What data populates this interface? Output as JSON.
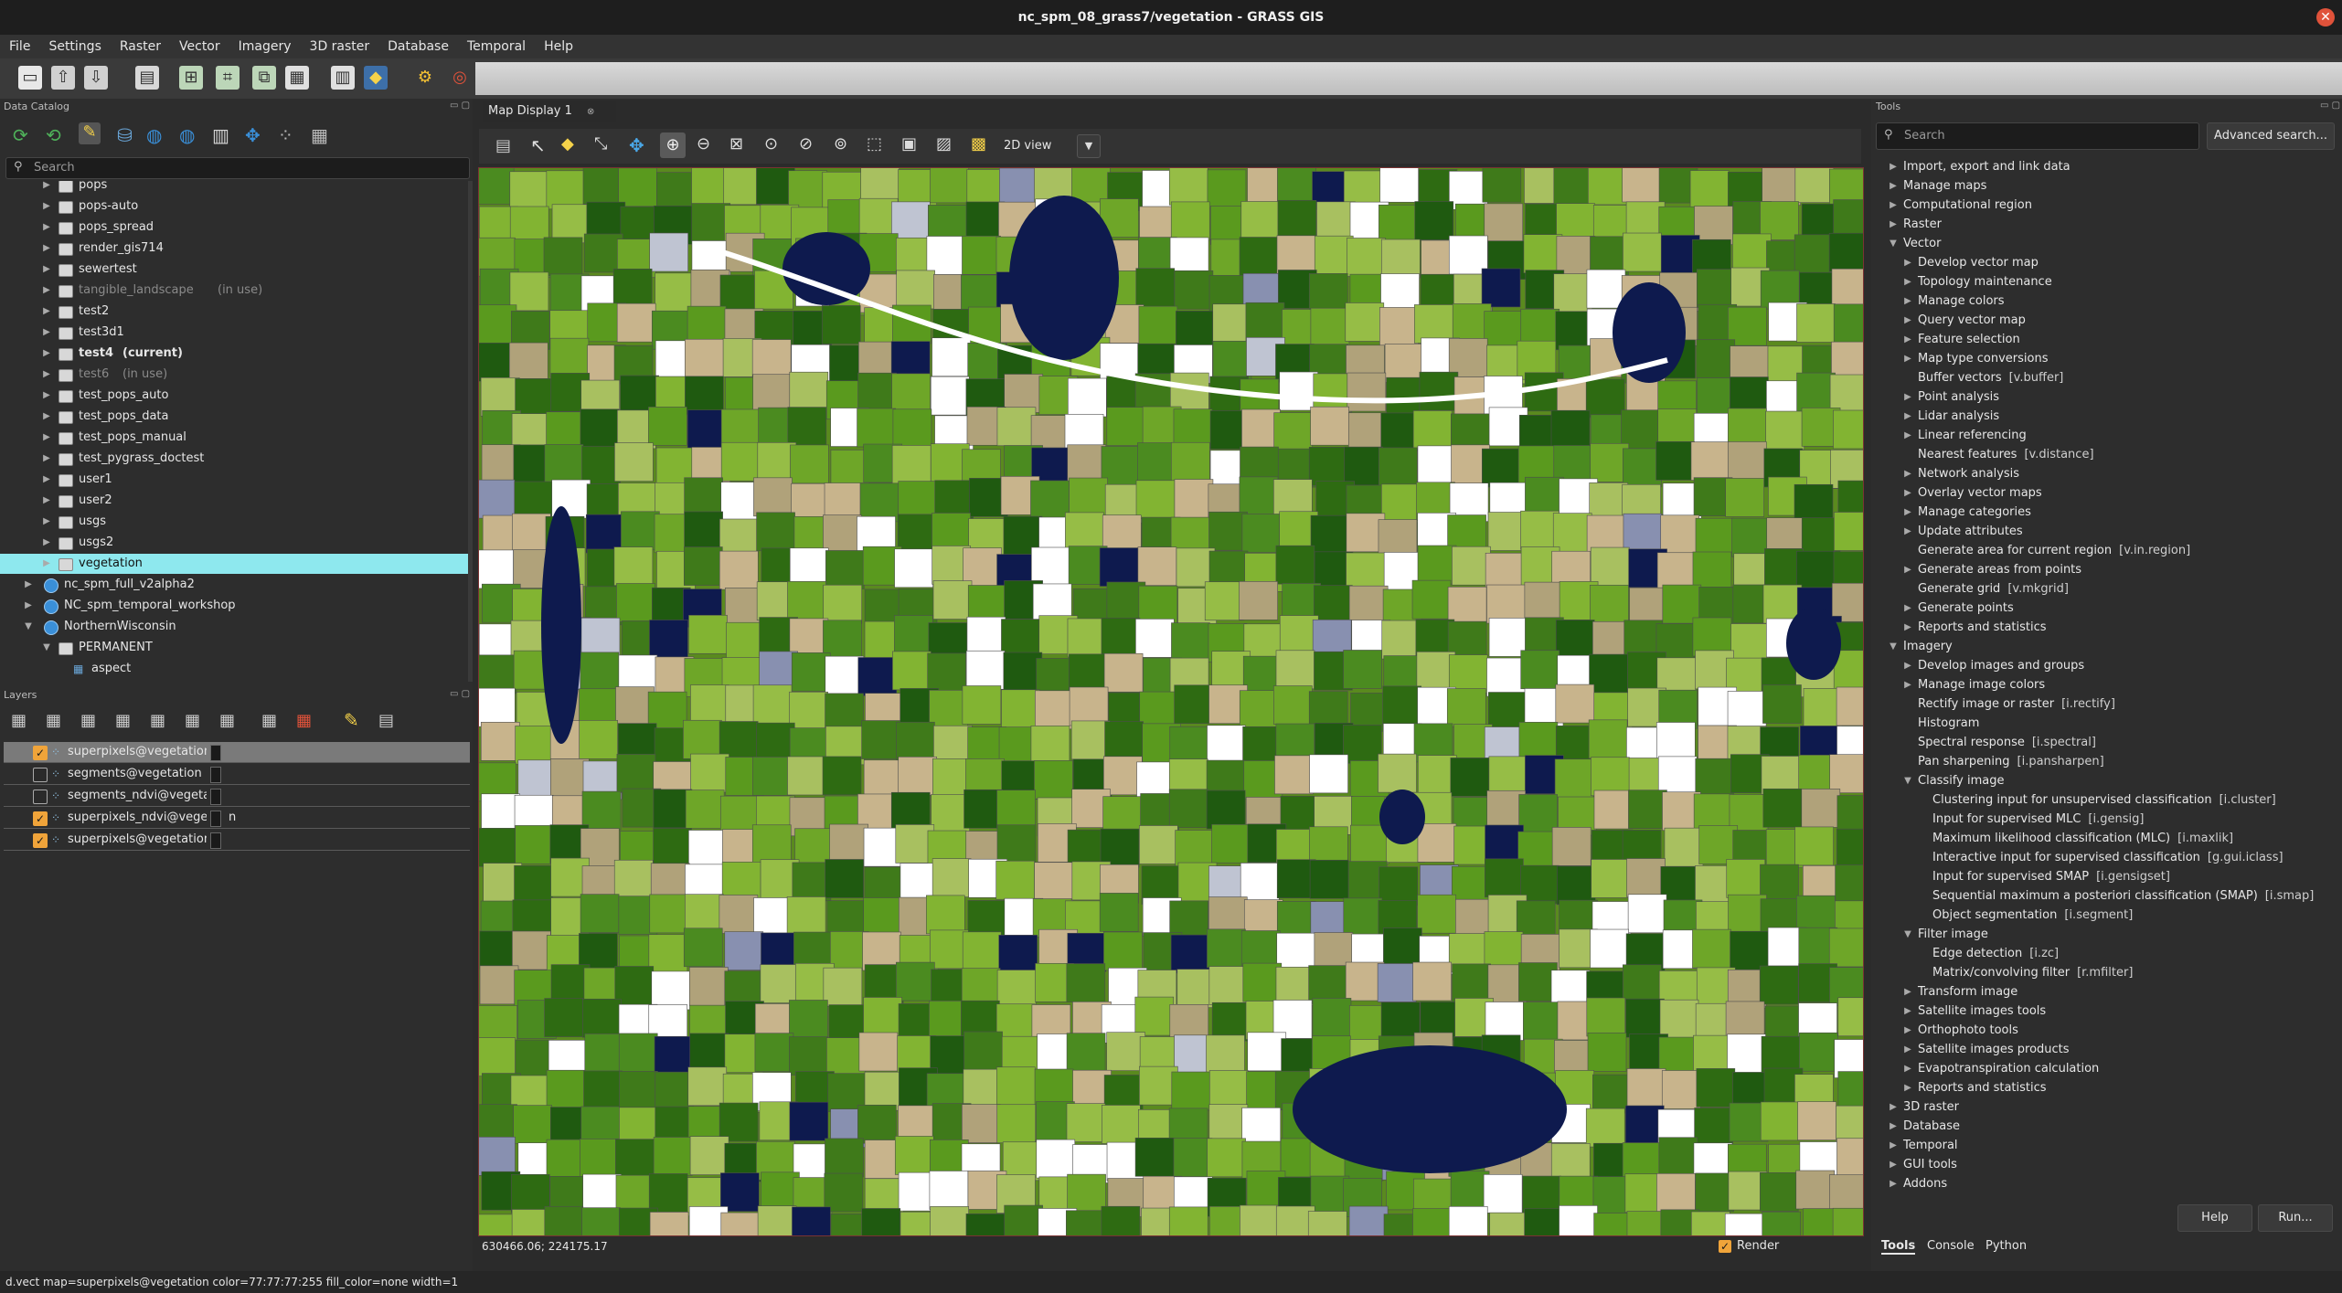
{
  "window": {
    "title": "nc_spm_08_grass7/vegetation - GRASS GIS"
  },
  "menubar": [
    "File",
    "Settings",
    "Raster",
    "Vector",
    "Imagery",
    "3D raster",
    "Database",
    "Temporal",
    "Help"
  ],
  "data_catalog": {
    "header": "Data Catalog",
    "search_placeholder": "Search",
    "items": [
      {
        "label": "pops",
        "suffix": "",
        "style": "normal"
      },
      {
        "label": "pops-auto",
        "suffix": "",
        "style": "normal"
      },
      {
        "label": "pops_spread",
        "suffix": "",
        "style": "normal"
      },
      {
        "label": "render_gis714",
        "suffix": "",
        "style": "normal"
      },
      {
        "label": "sewertest",
        "suffix": "",
        "style": "normal"
      },
      {
        "label": "tangible_landscape",
        "suffix": "(in use)",
        "style": "grey"
      },
      {
        "label": "test2",
        "suffix": "",
        "style": "normal"
      },
      {
        "label": "test3d1",
        "suffix": "",
        "style": "normal"
      },
      {
        "label": "test4",
        "suffix": "(current)",
        "style": "bold"
      },
      {
        "label": "test6",
        "suffix": "(in use)",
        "style": "grey"
      },
      {
        "label": "test_pops_auto",
        "suffix": "",
        "style": "normal"
      },
      {
        "label": "test_pops_data",
        "suffix": "",
        "style": "normal"
      },
      {
        "label": "test_pops_manual",
        "suffix": "",
        "style": "normal"
      },
      {
        "label": "test_pygrass_doctest",
        "suffix": "",
        "style": "normal"
      },
      {
        "label": "user1",
        "suffix": "",
        "style": "normal"
      },
      {
        "label": "user2",
        "suffix": "",
        "style": "normal"
      },
      {
        "label": "usgs",
        "suffix": "",
        "style": "normal"
      },
      {
        "label": "usgs2",
        "suffix": "",
        "style": "normal"
      },
      {
        "label": "vegetation",
        "suffix": "",
        "style": "selected"
      }
    ],
    "locations": [
      {
        "label": "nc_spm_full_v2alpha2"
      },
      {
        "label": "NC_spm_temporal_workshop"
      },
      {
        "label": "NorthernWisconsin"
      }
    ],
    "permanent": "PERMANENT",
    "aspect": "aspect"
  },
  "layers": {
    "header": "Layers",
    "items": [
      {
        "name": "superpixels@vegetation",
        "checked": true,
        "selected": true
      },
      {
        "name": "segments@vegetation",
        "checked": false,
        "selected": false
      },
      {
        "name": "segments_ndvi@vegetat",
        "checked": false,
        "selected": false
      },
      {
        "name": "superpixels_ndvi@veget",
        "checked": true,
        "selected": false,
        "trail": "n"
      },
      {
        "name": "superpixels@vegetation",
        "checked": true,
        "selected": false
      }
    ]
  },
  "map_display": {
    "tab_label": "Map Display 1",
    "view_mode": "2D view",
    "coordinates": "630466.06; 224175.17",
    "render_label": "Render",
    "render_checked": true
  },
  "tools": {
    "header": "Tools",
    "search_placeholder": "Search",
    "advanced_search": "Advanced search...",
    "tree": [
      {
        "label": "Import, export and link data",
        "cmd": "",
        "level": 0,
        "arrow": "right"
      },
      {
        "label": "Manage maps",
        "cmd": "",
        "level": 0,
        "arrow": "right"
      },
      {
        "label": "Computational region",
        "cmd": "",
        "level": 0,
        "arrow": "right"
      },
      {
        "label": "Raster",
        "cmd": "",
        "level": 0,
        "arrow": "right"
      },
      {
        "label": "Vector",
        "cmd": "",
        "level": 0,
        "arrow": "down"
      },
      {
        "label": "Develop vector map",
        "cmd": "",
        "level": 1,
        "arrow": "right"
      },
      {
        "label": "Topology maintenance",
        "cmd": "",
        "level": 1,
        "arrow": "right"
      },
      {
        "label": "Manage colors",
        "cmd": "",
        "level": 1,
        "arrow": "right"
      },
      {
        "label": "Query vector map",
        "cmd": "",
        "level": 1,
        "arrow": "right"
      },
      {
        "label": "Feature selection",
        "cmd": "",
        "level": 1,
        "arrow": "right"
      },
      {
        "label": "Map type conversions",
        "cmd": "",
        "level": 1,
        "arrow": "right"
      },
      {
        "label": "Buffer vectors",
        "cmd": "[v.buffer]",
        "level": 1,
        "arrow": ""
      },
      {
        "label": "Point analysis",
        "cmd": "",
        "level": 1,
        "arrow": "right"
      },
      {
        "label": "Lidar analysis",
        "cmd": "",
        "level": 1,
        "arrow": "right"
      },
      {
        "label": "Linear referencing",
        "cmd": "",
        "level": 1,
        "arrow": "right"
      },
      {
        "label": "Nearest features",
        "cmd": "[v.distance]",
        "level": 1,
        "arrow": ""
      },
      {
        "label": "Network analysis",
        "cmd": "",
        "level": 1,
        "arrow": "right"
      },
      {
        "label": "Overlay vector maps",
        "cmd": "",
        "level": 1,
        "arrow": "right"
      },
      {
        "label": "Manage categories",
        "cmd": "",
        "level": 1,
        "arrow": "right"
      },
      {
        "label": "Update attributes",
        "cmd": "",
        "level": 1,
        "arrow": "right"
      },
      {
        "label": "Generate area for current region",
        "cmd": "[v.in.region]",
        "level": 1,
        "arrow": ""
      },
      {
        "label": "Generate areas from points",
        "cmd": "",
        "level": 1,
        "arrow": "right"
      },
      {
        "label": "Generate grid",
        "cmd": "[v.mkgrid]",
        "level": 1,
        "arrow": ""
      },
      {
        "label": "Generate points",
        "cmd": "",
        "level": 1,
        "arrow": "right"
      },
      {
        "label": "Reports and statistics",
        "cmd": "",
        "level": 1,
        "arrow": "right"
      },
      {
        "label": "Imagery",
        "cmd": "",
        "level": 0,
        "arrow": "down"
      },
      {
        "label": "Develop images and groups",
        "cmd": "",
        "level": 1,
        "arrow": "right"
      },
      {
        "label": "Manage image colors",
        "cmd": "",
        "level": 1,
        "arrow": "right"
      },
      {
        "label": "Rectify image or raster",
        "cmd": "[i.rectify]",
        "level": 1,
        "arrow": ""
      },
      {
        "label": "Histogram",
        "cmd": "",
        "level": 1,
        "arrow": ""
      },
      {
        "label": "Spectral response",
        "cmd": "[i.spectral]",
        "level": 1,
        "arrow": ""
      },
      {
        "label": "Pan sharpening",
        "cmd": "[i.pansharpen]",
        "level": 1,
        "arrow": ""
      },
      {
        "label": "Classify image",
        "cmd": "",
        "level": 1,
        "arrow": "down"
      },
      {
        "label": "Clustering input for unsupervised classification",
        "cmd": "[i.cluster]",
        "level": 2,
        "arrow": ""
      },
      {
        "label": "Input for supervised MLC",
        "cmd": "[i.gensig]",
        "level": 2,
        "arrow": ""
      },
      {
        "label": "Maximum likelihood classification (MLC)",
        "cmd": "[i.maxlik]",
        "level": 2,
        "arrow": ""
      },
      {
        "label": "Interactive input for supervised classification",
        "cmd": "[g.gui.iclass]",
        "level": 2,
        "arrow": ""
      },
      {
        "label": "Input for supervised SMAP",
        "cmd": "[i.gensigset]",
        "level": 2,
        "arrow": ""
      },
      {
        "label": "Sequential maximum a posteriori classification (SMAP)",
        "cmd": "[i.smap]",
        "level": 2,
        "arrow": ""
      },
      {
        "label": "Object segmentation",
        "cmd": "[i.segment]",
        "level": 2,
        "arrow": ""
      },
      {
        "label": "Filter image",
        "cmd": "",
        "level": 1,
        "arrow": "down"
      },
      {
        "label": "Edge detection",
        "cmd": "[i.zc]",
        "level": 2,
        "arrow": ""
      },
      {
        "label": "Matrix/convolving filter",
        "cmd": "[r.mfilter]",
        "level": 2,
        "arrow": ""
      },
      {
        "label": "Transform image",
        "cmd": "",
        "level": 1,
        "arrow": "right"
      },
      {
        "label": "Satellite images tools",
        "cmd": "",
        "level": 1,
        "arrow": "right"
      },
      {
        "label": "Orthophoto tools",
        "cmd": "",
        "level": 1,
        "arrow": "right"
      },
      {
        "label": "Satellite images products",
        "cmd": "",
        "level": 1,
        "arrow": "right"
      },
      {
        "label": "Evapotranspiration calculation",
        "cmd": "",
        "level": 1,
        "arrow": "right"
      },
      {
        "label": "Reports and statistics",
        "cmd": "",
        "level": 1,
        "arrow": "right"
      },
      {
        "label": "3D raster",
        "cmd": "",
        "level": 0,
        "arrow": "right"
      },
      {
        "label": "Database",
        "cmd": "",
        "level": 0,
        "arrow": "right"
      },
      {
        "label": "Temporal",
        "cmd": "",
        "level": 0,
        "arrow": "right"
      },
      {
        "label": "GUI tools",
        "cmd": "",
        "level": 0,
        "arrow": "right"
      },
      {
        "label": "Addons",
        "cmd": "",
        "level": 0,
        "arrow": "right"
      }
    ],
    "help_button": "Help",
    "run_button": "Run...",
    "bottom_tabs": [
      "Tools",
      "Console",
      "Python"
    ]
  },
  "statusbar": {
    "command": "d.vect map=superpixels@vegetation color=77:77:77:255 fill_color=none width=1"
  },
  "colors": {
    "selected_row": "#8ee8ee",
    "map_greens": [
      "#3f7a1a",
      "#5a9a1e",
      "#6ea628",
      "#82b432",
      "#96bd46",
      "#4b8b20",
      "#2e6b12",
      "#a8c060",
      "#1f5a10"
    ],
    "map_other": [
      "#c8b48c",
      "#b0a27a",
      "#ffffff",
      "#0e1a4e",
      "#8890b0",
      "#bfc4d2"
    ]
  }
}
